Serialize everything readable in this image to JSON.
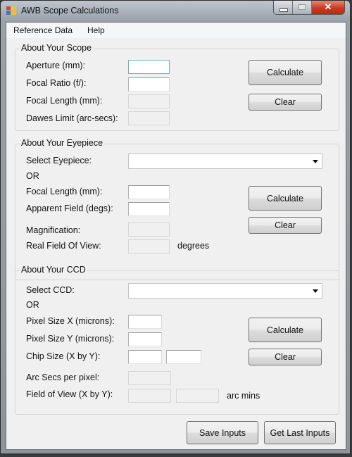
{
  "window": {
    "title": "AWB Scope Calculations",
    "caption": {
      "minimize": "minimize",
      "maximize": "maximize",
      "close": "✕"
    }
  },
  "menu": [
    {
      "label": "Reference Data"
    },
    {
      "label": "Help"
    }
  ],
  "scope": {
    "title": "About Your Scope",
    "aperture_label": "Aperture (mm):",
    "aperture_value": "",
    "focal_ratio_label": "Focal Ratio (f/):",
    "focal_ratio_value": "",
    "focal_length_label": "Focal Length (mm):",
    "focal_length_value": "",
    "dawes_label": "Dawes Limit (arc-secs):",
    "dawes_value": "",
    "calculate_label": "Calculate",
    "clear_label": "Clear"
  },
  "eyepiece": {
    "title": "About Your Eyepiece",
    "select_label": "Select Eyepiece:",
    "select_value": "",
    "or_label": "OR",
    "focal_length_label": "Focal Length (mm):",
    "focal_length_value": "",
    "apparent_field_label": "Apparent Field (degs):",
    "apparent_field_value": "",
    "magnification_label": "Magnification:",
    "magnification_value": "",
    "real_fov_label": "Real Field Of View:",
    "real_fov_value": "",
    "real_fov_unit": "degrees",
    "calculate_label": "Calculate",
    "clear_label": "Clear"
  },
  "ccd": {
    "title": "About Your CCD",
    "select_label": "Select CCD:",
    "select_value": "",
    "or_label": "OR",
    "pixel_x_label": "Pixel Size X (microns):",
    "pixel_x_value": "",
    "pixel_y_label": "Pixel Size Y (microns):",
    "pixel_y_value": "",
    "chip_size_label": "Chip Size (X by Y):",
    "chip_x_value": "",
    "chip_y_value": "",
    "arcsec_label": "Arc Secs per pixel:",
    "arcsec_value": "",
    "fov_label": "Field of View (X by Y):",
    "fov_x_value": "",
    "fov_y_value": "",
    "fov_unit": "arc mins",
    "calculate_label": "Calculate",
    "clear_label": "Clear"
  },
  "footer": {
    "save_label": "Save Inputs",
    "load_label": "Get Last Inputs"
  }
}
